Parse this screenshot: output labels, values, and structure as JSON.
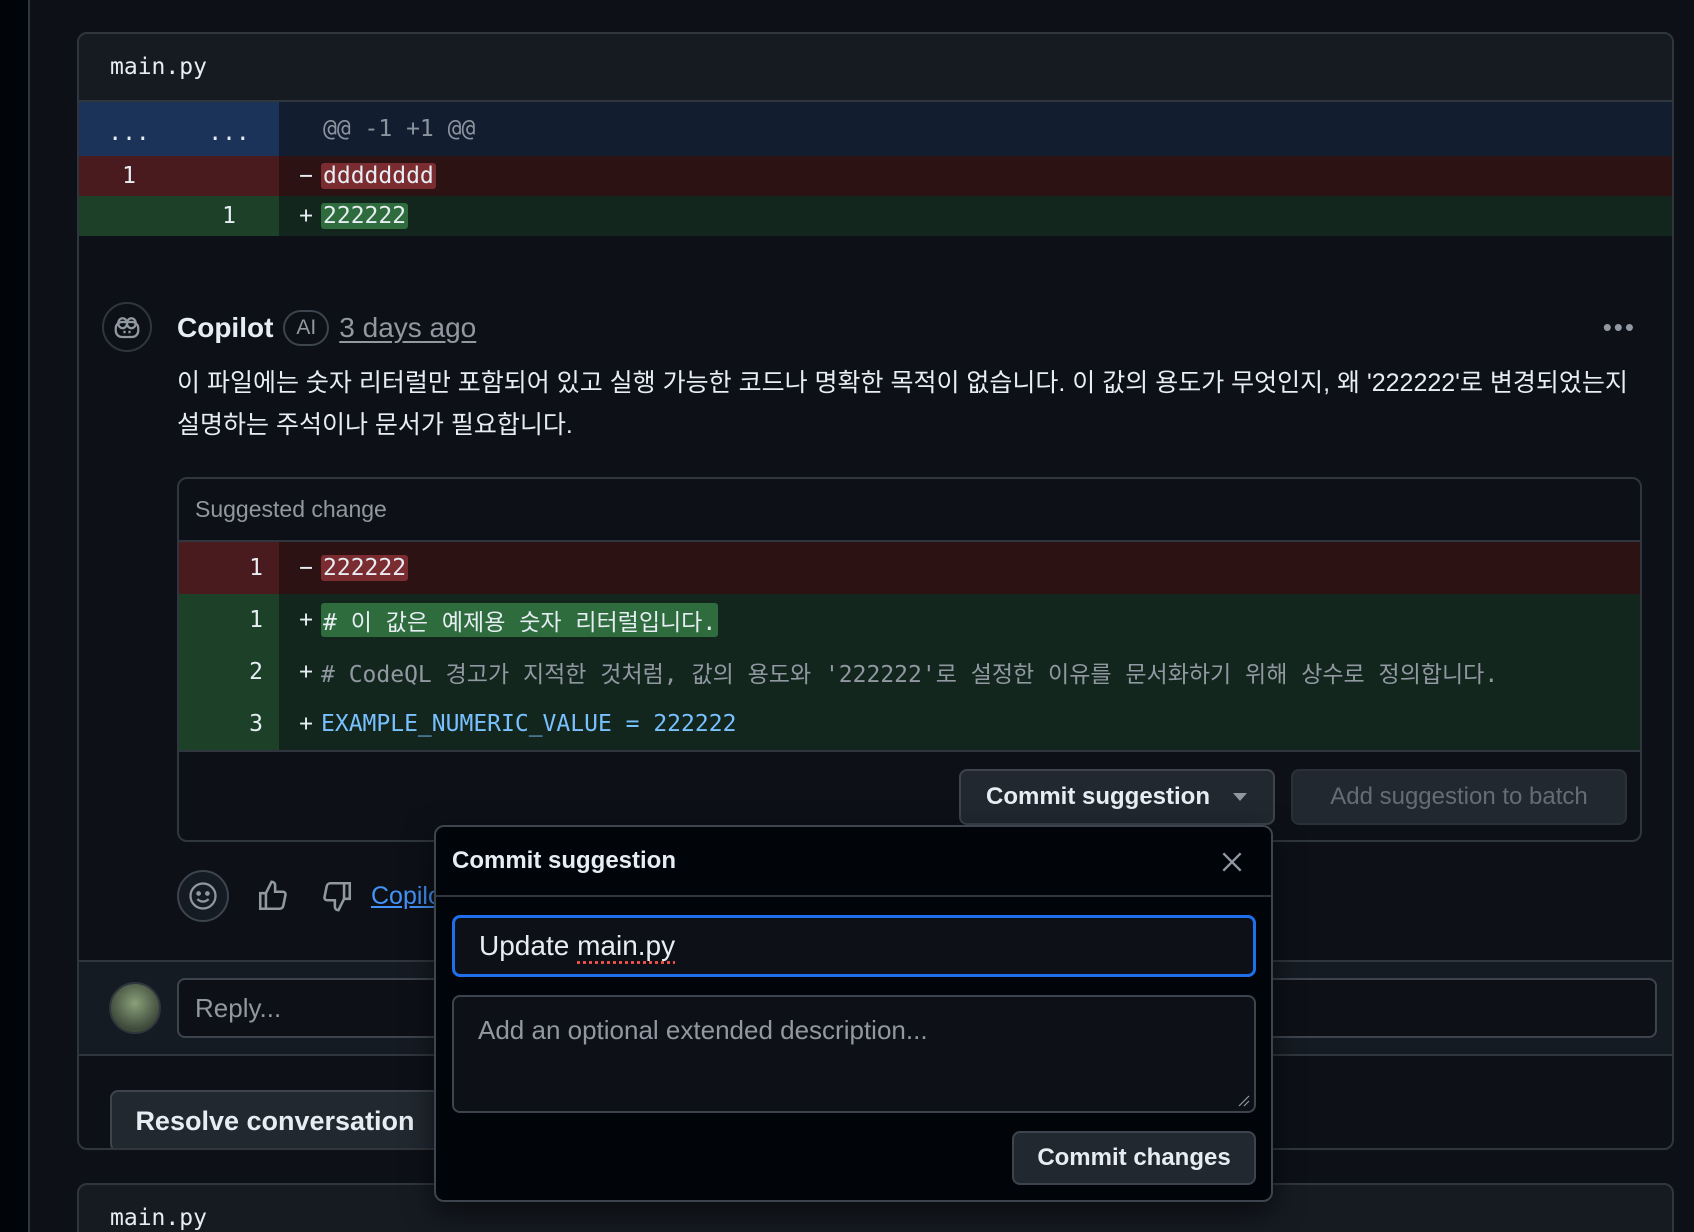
{
  "file": {
    "name": "main.py"
  },
  "diff": {
    "hunk_left": "...",
    "hunk_right": "...",
    "hunk_header": "@@ -1 +1 @@",
    "rows": [
      {
        "type": "del",
        "old": "1",
        "new": "",
        "sign": "−",
        "text": "dddddddd"
      },
      {
        "type": "add",
        "old": "",
        "new": "1",
        "sign": "+",
        "text": "222222"
      }
    ]
  },
  "comment": {
    "author": "Copilot",
    "badge": "AI",
    "time": "3 days ago",
    "body": "이 파일에는 숫자 리터럴만 포함되어 있고 실행 가능한 코드나 명확한 목적이 없습니다. 이 값의 용도가 무엇인지, 왜 '222222'로 변경되었는지 설명하는 주석이나 문서가 필요합니다.",
    "more_icon": "kebab-horizontal-icon"
  },
  "suggestion": {
    "title": "Suggested change",
    "rows": [
      {
        "type": "del",
        "line": "1",
        "sign": "−",
        "text": "222222"
      },
      {
        "type": "add",
        "line": "1",
        "sign": "+",
        "text": "# 이 값은 예제용 숫자 리터럴입니다."
      },
      {
        "type": "add",
        "line": "2",
        "sign": "+",
        "text": "# CodeQL 경고가 지적한 것처럼, 값의 용도와 '222222'로 설정한 이유를 문서화하기 위해 상수로 정의합니다."
      },
      {
        "type": "add",
        "line": "3",
        "sign": "+",
        "text": "EXAMPLE_NUMERIC_VALUE = 222222"
      }
    ],
    "commit_button": "Commit suggestion",
    "batch_button": "Add suggestion to batch"
  },
  "reactions": {
    "link": "Copilot"
  },
  "reply": {
    "placeholder": "Reply..."
  },
  "resolve_button": "Resolve conversation",
  "file2": {
    "name": "main.py"
  },
  "modal": {
    "title": "Commit suggestion",
    "message_value": "Update main.py",
    "message_plain": "Update ",
    "message_squiggle": "main.py",
    "description_placeholder": "Add an optional extended description...",
    "submit": "Commit changes"
  },
  "colors": {
    "accent": "#1f6feb",
    "link": "#4493f8",
    "del": "#4a1b1e",
    "add": "#1d4028"
  }
}
